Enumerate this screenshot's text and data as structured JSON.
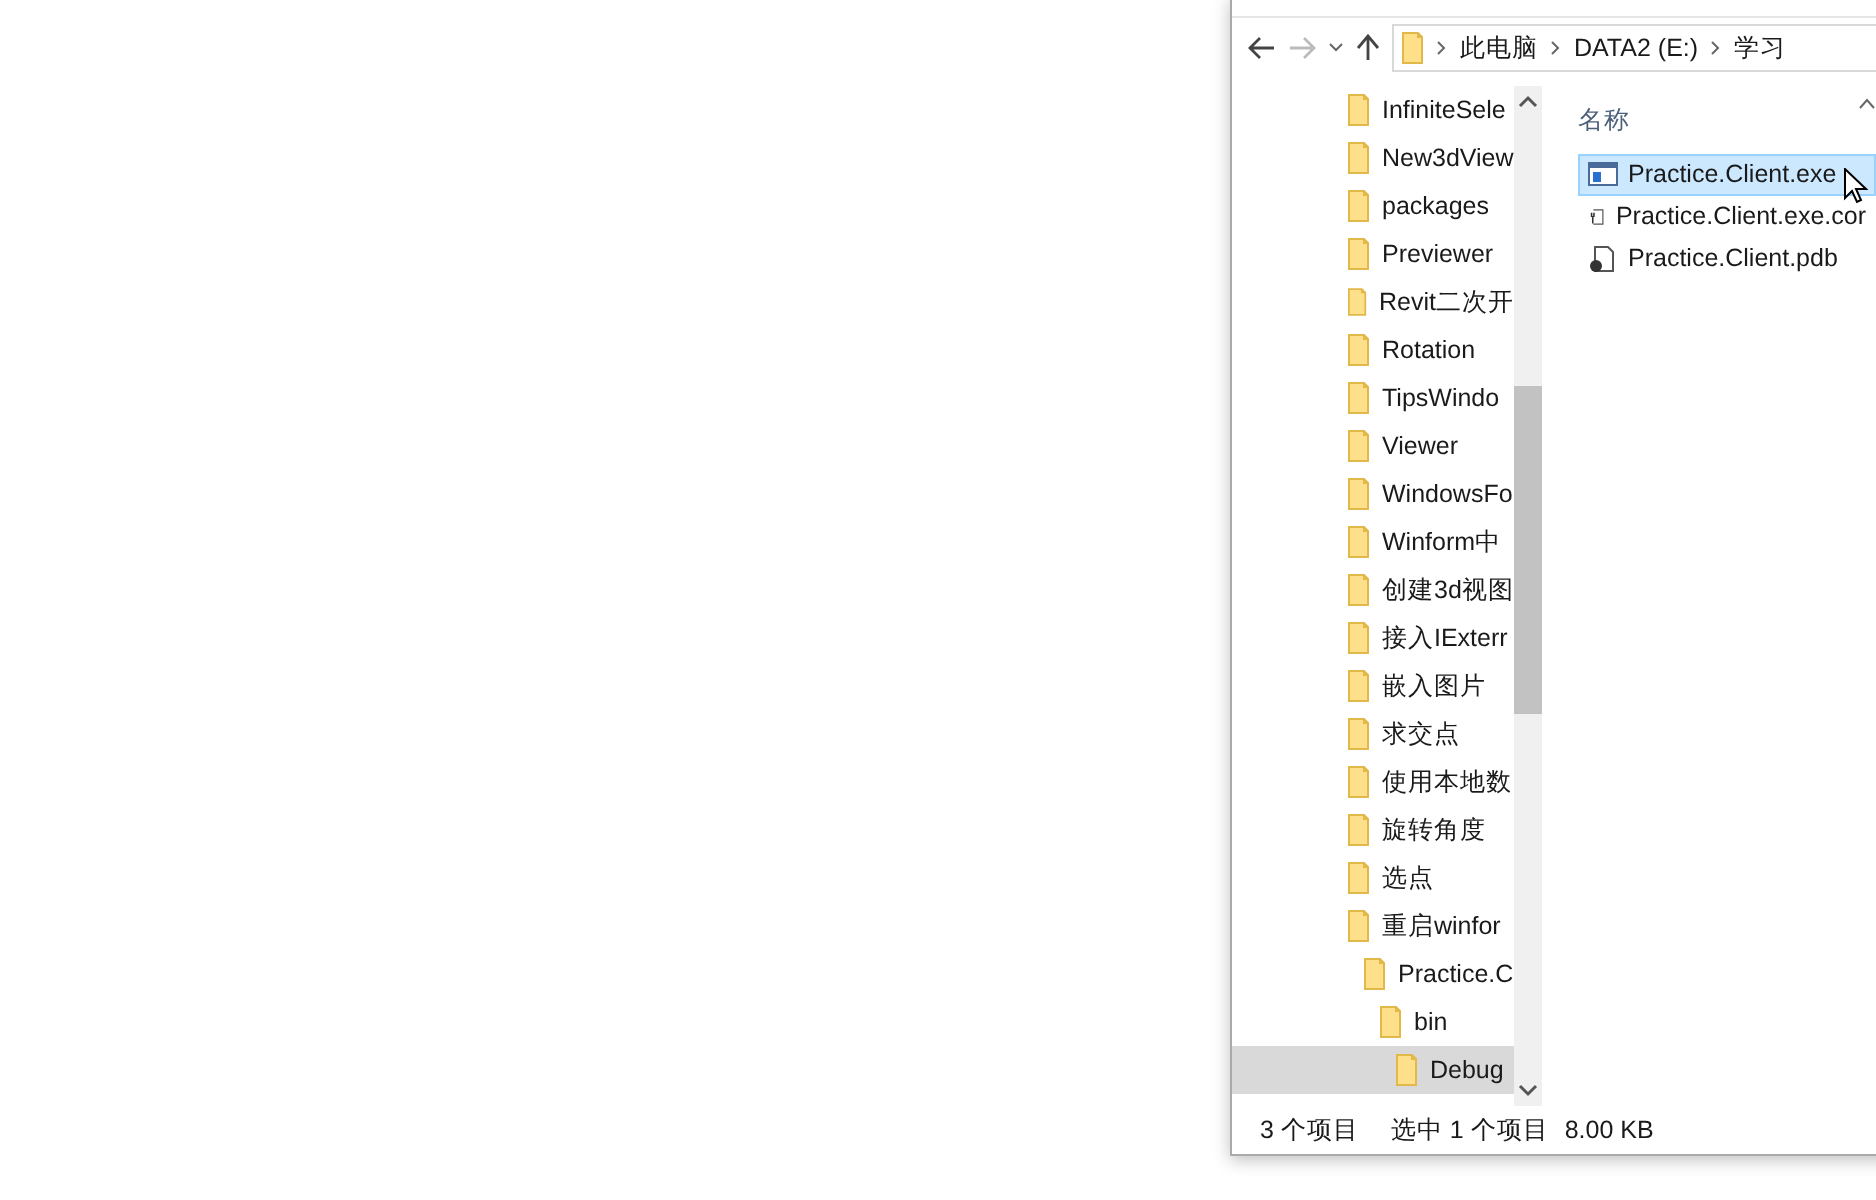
{
  "address_bar": {
    "crumbs": [
      "此电脑",
      "DATA2 (E:)",
      "学习"
    ]
  },
  "nav_tree": [
    {
      "label": "InfiniteSele",
      "selected": false
    },
    {
      "label": "New3dView",
      "selected": false
    },
    {
      "label": "packages",
      "selected": false
    },
    {
      "label": "Previewer",
      "selected": false
    },
    {
      "label": "Revit二次开",
      "selected": false
    },
    {
      "label": "Rotation",
      "selected": false
    },
    {
      "label": "TipsWindo",
      "selected": false
    },
    {
      "label": "Viewer",
      "selected": false
    },
    {
      "label": "WindowsFo",
      "selected": false
    },
    {
      "label": "Winform中",
      "selected": false
    },
    {
      "label": "创建3d视图",
      "selected": false
    },
    {
      "label": "接入IExterr",
      "selected": false
    },
    {
      "label": "嵌入图片",
      "selected": false
    },
    {
      "label": "求交点",
      "selected": false
    },
    {
      "label": "使用本地数",
      "selected": false
    },
    {
      "label": "旋转角度",
      "selected": false
    },
    {
      "label": "选点",
      "selected": false
    },
    {
      "label": "重启winfor",
      "selected": false,
      "children": [
        {
          "label": "Practice.C",
          "selected": false,
          "children": [
            {
              "label": "bin",
              "selected": false,
              "children": [
                {
                  "label": "Debug",
                  "selected": true
                }
              ]
            }
          ]
        }
      ]
    }
  ],
  "file_list": {
    "column": "名称",
    "files": [
      {
        "name": "Practice.Client.exe",
        "kind": "exe",
        "selected": true
      },
      {
        "name": "Practice.Client.exe.cor",
        "kind": "config",
        "selected": false
      },
      {
        "name": "Practice.Client.pdb",
        "kind": "pdb",
        "selected": false
      }
    ]
  },
  "status_bar": [
    "3 个项目",
    "选中 1 个项目",
    "8.00 KB"
  ]
}
